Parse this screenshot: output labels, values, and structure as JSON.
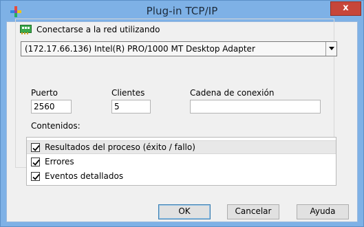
{
  "window": {
    "title": "Plug-in TCP/IP",
    "close_label": "x"
  },
  "network": {
    "label": "Conectarse a la red utilizando",
    "selected_adapter": "(172.17.66.136) Intel(R) PRO/1000 MT Desktop Adapter"
  },
  "fields": {
    "port_label": "Puerto",
    "port_value": "2560",
    "clients_label": "Clientes",
    "clients_value": "5",
    "connection_label": "Cadena de conexión",
    "connection_value": ""
  },
  "contents": {
    "label": "Contenidos:",
    "items": [
      {
        "label": "Resultados del proceso (éxito / fallo)",
        "checked": true
      },
      {
        "label": "Errores",
        "checked": true
      },
      {
        "label": "Eventos detallados",
        "checked": true
      }
    ]
  },
  "buttons": {
    "ok": "OK",
    "cancel": "Cancelar",
    "help": "Ayuda"
  },
  "icons": {
    "app": "plugin-icon",
    "network": "network-card-icon"
  },
  "colors": {
    "titlebar": "#7eb1e6",
    "close_button": "#c7463a",
    "client_background": "#f0f0f0"
  }
}
